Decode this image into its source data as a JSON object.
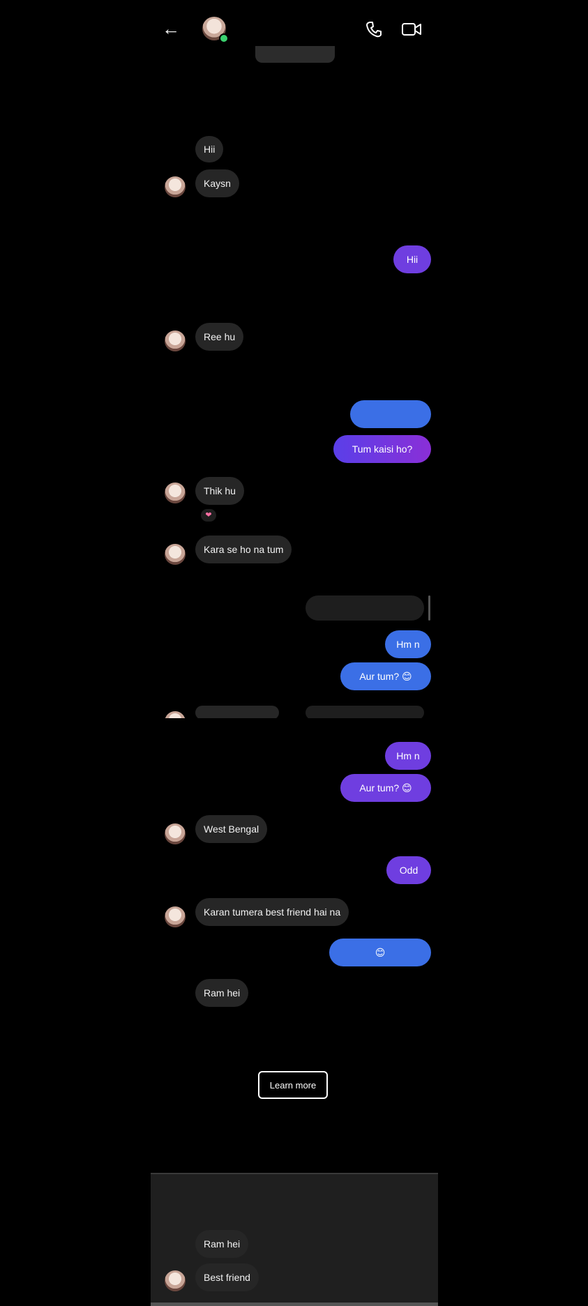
{
  "status": {
    "left": "",
    "right": ""
  },
  "header": {
    "back_icon": "arrow-left-icon",
    "contact_name": "",
    "contact_sub": "",
    "call_icon": "phone-icon",
    "video_icon": "video-camera-icon"
  },
  "top_pill": "",
  "timestamps": [
    "",
    "",
    "",
    "",
    "",
    ""
  ],
  "messages": {
    "m1": "Hii",
    "m2": "Kaysn",
    "m3": "Hii",
    "m4": "Ree hu",
    "m5": "",
    "m6": "Tum kaisi ho?",
    "m7": "Thik hu",
    "m8": "Kara se ho na tum",
    "m10": "Hm n",
    "m11": "Aur tum?",
    "m12": "West Bengal",
    "m13": "Odd",
    "m14": "Karan tumera best friend hai na",
    "m15": "",
    "m16": "Ram hei"
  },
  "reply": {
    "label": "",
    "preview": ""
  },
  "reaction": "heart",
  "vanish": {
    "note": "",
    "learn_more": "Learn more"
  },
  "vanish_panel": {
    "title": "",
    "m1": "Ram hei",
    "m2": "Best friend"
  },
  "colors": {
    "incoming_bubble": "#262626",
    "outgoing_purple": "#6f3ee0",
    "outgoing_blue": "#3b6fe6",
    "background": "#000000"
  }
}
